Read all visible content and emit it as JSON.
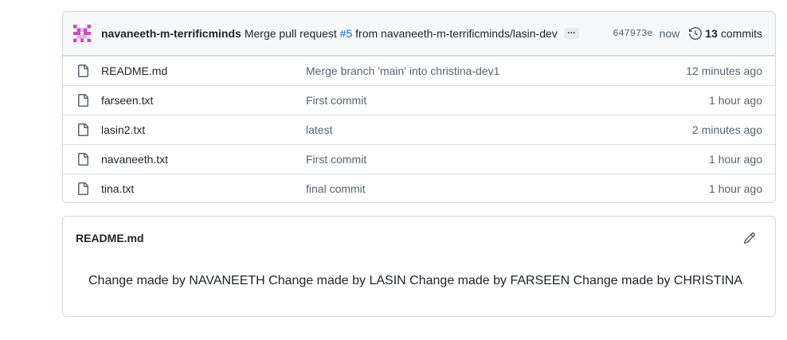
{
  "commit": {
    "author": "navaneeth-m-terrificminds",
    "message_prefix": "Merge pull request ",
    "pr_link": "#5",
    "message_suffix": " from navaneeth-m-terrificminds/lasin-dev",
    "ellipsis": "…",
    "sha": "647973e",
    "time": "now",
    "commit_count": "13",
    "commit_label": "commits",
    "avatar_color": "#c74ec0"
  },
  "files": [
    {
      "name": "README.md",
      "message": "Merge branch 'main' into christina-dev1",
      "time": "12 minutes ago"
    },
    {
      "name": "farseen.txt",
      "message": "First commit",
      "time": "1 hour ago"
    },
    {
      "name": "lasin2.txt",
      "message": "latest",
      "time": "2 minutes ago"
    },
    {
      "name": "navaneeth.txt",
      "message": "First commit",
      "time": "1 hour ago"
    },
    {
      "name": "tina.txt",
      "message": "final commit",
      "time": "1 hour ago"
    }
  ],
  "readme": {
    "title": "README.md",
    "content": "Change made by NAVANEETH Change made by LASIN Change made by FARSEEN Change made by CHRISTINA"
  },
  "icons": {
    "file": "file-icon",
    "history": "history-icon",
    "edit": "pencil-icon",
    "avatar": "identicon-avatar"
  }
}
